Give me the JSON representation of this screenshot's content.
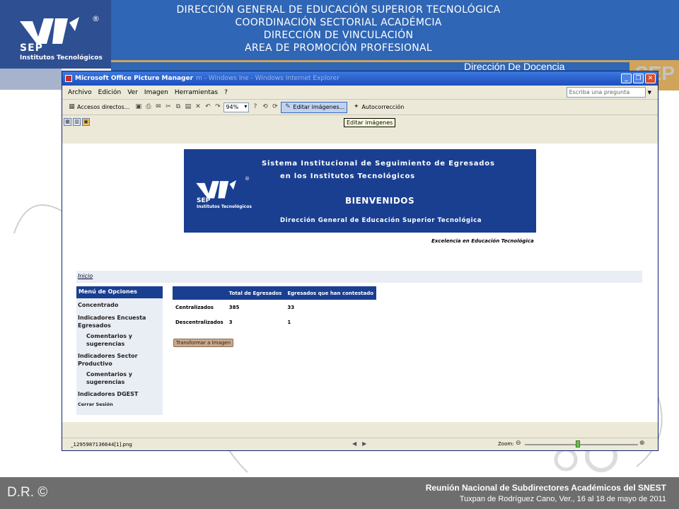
{
  "header": {
    "logo_text": "SEP",
    "logo_sub": "Institutos Tecnológicos",
    "registered": "®",
    "banner_lines": [
      "DIRECCIÓN GENERAL DE EDUCACIÓN SUPERIOR TECNOLÓGICA",
      "COORDINACIÓN SECTORIAL ACADÉMCIA",
      "DIRECCIÓN DE VINCULACIÓN",
      "AREA DE PROMOCIÓN PROFESIONAL"
    ],
    "docencia": "Dirección De Docencia",
    "sep_right": "SEP"
  },
  "window": {
    "title": "Microsoft Office Picture Manager",
    "title_ghost": "m - Windows Ine - Windows Internet Explorer",
    "menu": [
      "Archivo",
      "Edición",
      "Ver",
      "Imagen",
      "Herramientas",
      "?"
    ],
    "ask_placeholder": "Escriba una pregunta",
    "toolbar": {
      "shortcuts": "Accesos directos...",
      "zoom_value": "94%",
      "edit_images": "Editar imágenes...",
      "autocorrect": "Autocorrección"
    },
    "tooltip": "Editar imágenes",
    "status": {
      "filename": "_1295987136644[1].png",
      "zoom_label": "Zoom:"
    }
  },
  "webpage": {
    "hero": {
      "line1": "Sistema Institucional de Seguimiento de Egresados",
      "line2": "en los Institutos Tecnológicos",
      "welcome": "BIENVENIDOS",
      "dgest": "Dirección General de Educación Superior Tecnológica",
      "logo_text": "SEP",
      "logo_sub": "Institutos Tecnológicos",
      "registered": "®"
    },
    "excellence": "Excelencia en Educación Tecnológica",
    "breadcrumb": "Inicio",
    "menu_title": "Menú de Opciones",
    "menu_items": [
      {
        "label": "Concentrado",
        "level": 0
      },
      {
        "label": "Indicadores Encuesta Egresados",
        "level": 0
      },
      {
        "label": "Comentarios y sugerencias",
        "level": 1
      },
      {
        "label": "Indicadores Sector Productivo",
        "level": 0
      },
      {
        "label": "Comentarios y sugerencias",
        "level": 1
      },
      {
        "label": "Indicadores DGEST",
        "level": 0
      },
      {
        "label": "Cerrar Sesión",
        "level": 0
      }
    ],
    "table": {
      "headers": [
        "",
        "Total de Egresados",
        "Egresados que han contestado"
      ],
      "rows": [
        [
          "Centralizados",
          "385",
          "33"
        ],
        [
          "Descentralizados",
          "3",
          "1"
        ]
      ]
    },
    "transform_button": "Transformar a Imagen"
  },
  "footer": {
    "dr": "D.R. ©",
    "line1": "Reunión Nacional de Subdirectores Académicos del SNEST",
    "line2": "Tuxpan de Rodríguez  Cano, Ver.,  16 al 18 de mayo de 2011"
  }
}
